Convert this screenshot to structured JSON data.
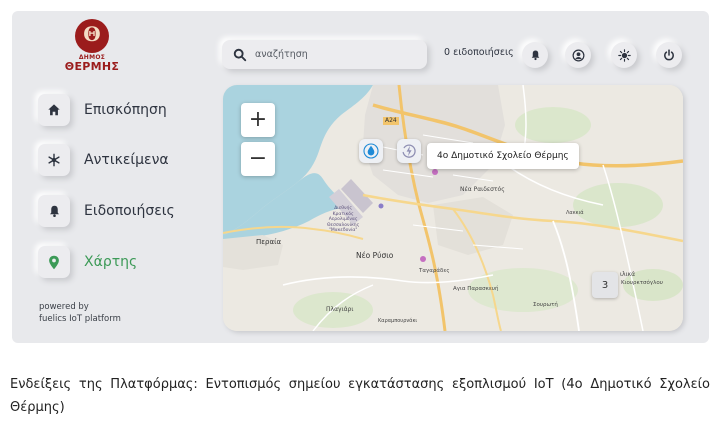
{
  "brand": {
    "logo_glyph": "Θ",
    "municipality_small": "ΔΗΜΟΣ",
    "municipality_big": "ΘΕΡΜΗΣ",
    "color": "#9b1c1c"
  },
  "search": {
    "placeholder": "αναζήτηση"
  },
  "header": {
    "notifications_label": "0 ειδοποιήσεις"
  },
  "icons": {
    "search": "search-icon",
    "bell": "bell-icon",
    "user": "user-icon",
    "settings": "sun-icon",
    "power": "power-icon",
    "home": "home-icon",
    "objects": "snowflake-icon",
    "location": "location-pin-icon",
    "water": "water-drop-icon",
    "energy": "energy-icon"
  },
  "sidebar": {
    "items": [
      {
        "label": "Επισκόπηση",
        "icon": "home-icon",
        "active": false
      },
      {
        "label": "Αντικείμενα",
        "icon": "snowflake-icon",
        "active": false
      },
      {
        "label": "Ειδοποιήσεις",
        "icon": "bell-icon",
        "active": false
      },
      {
        "label": "Χάρτης",
        "icon": "location-pin-icon",
        "active": true
      }
    ],
    "powered_line1": "powered by",
    "powered_line2": "fuelics IoT platform"
  },
  "map": {
    "zoom_in": "+",
    "zoom_out": "−",
    "tooltip": "4ο Δημοτικό Σχολείο Θέρμης",
    "cluster_count": "3",
    "labels": {
      "a24": "A24",
      "nea_raidestos": "Νέα Ραιδεστός",
      "lakkia": "Λακκιά",
      "peraia": "Περαία",
      "airport_1": "Διεθνής",
      "airport_2": "Κρατικός",
      "airport_3": "Αερολιμένας",
      "airport_4": "Θεσσαλονίκης",
      "airport_5": "\"Μακεδονία\"",
      "nea_rysio": "Νέο Ρύσιο",
      "tagarades": "Ταγαράδες",
      "agia_paraskevi": "Αγια Παρασκευή",
      "plagiari": "Πλαγιάρι",
      "karampournaki": "Καραμπουρνάκι",
      "sourotí": "Σουρωτή",
      "kouvekchi": "Κιουρκτσόγλου",
      "ilika": "ιλικά"
    }
  },
  "colors": {
    "accent_active": "#3c9a57",
    "panel_bg": "#e8e9ec",
    "water": "#aad3df",
    "road": "#f2c46b"
  },
  "caption": "Ενδείξεις της Πλατφόρμας: Εντοπισμός σημείου εγκατάστασης εξοπλισμού IoT (4ο Δημοτικό Σχολείο Θέρμης)"
}
